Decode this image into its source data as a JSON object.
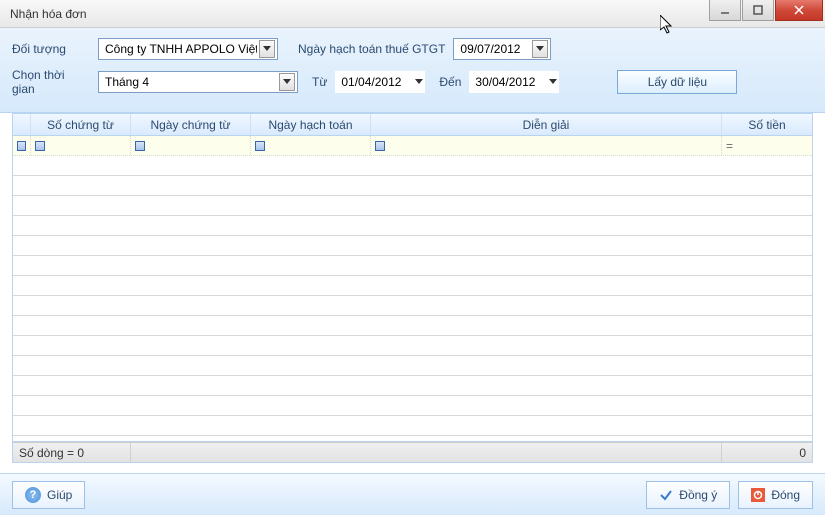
{
  "window": {
    "title": "Nhận hóa đơn"
  },
  "form": {
    "doi_tuong_label": "Đối tượng",
    "doi_tuong_value": "Công ty TNHH APPOLO Việt Na",
    "ngay_hach_toan_label": "Ngày hạch toán thuế GTGT",
    "ngay_hach_toan_value": "09/07/2012",
    "chon_thoi_gian_label": "Chọn thời gian",
    "chon_thoi_gian_value": "Tháng 4",
    "tu_label": "Từ",
    "tu_value": "01/04/2012",
    "den_label": "Đến",
    "den_value": "30/04/2012",
    "lay_du_lieu_label": "Lấy dữ liệu"
  },
  "grid": {
    "columns": {
      "so_chung_tu": "Số chứng từ",
      "ngay_chung_tu": "Ngày chứng từ",
      "ngay_hach_toan": "Ngày hạch toán",
      "dien_giai": "Diễn giải",
      "so_tien": "Số tiền"
    },
    "footer": {
      "row_count_label": "Số dòng = 0",
      "sum_value": "0"
    }
  },
  "buttons": {
    "help": "Giúp",
    "ok": "Đồng ý",
    "close": "Đóng"
  }
}
